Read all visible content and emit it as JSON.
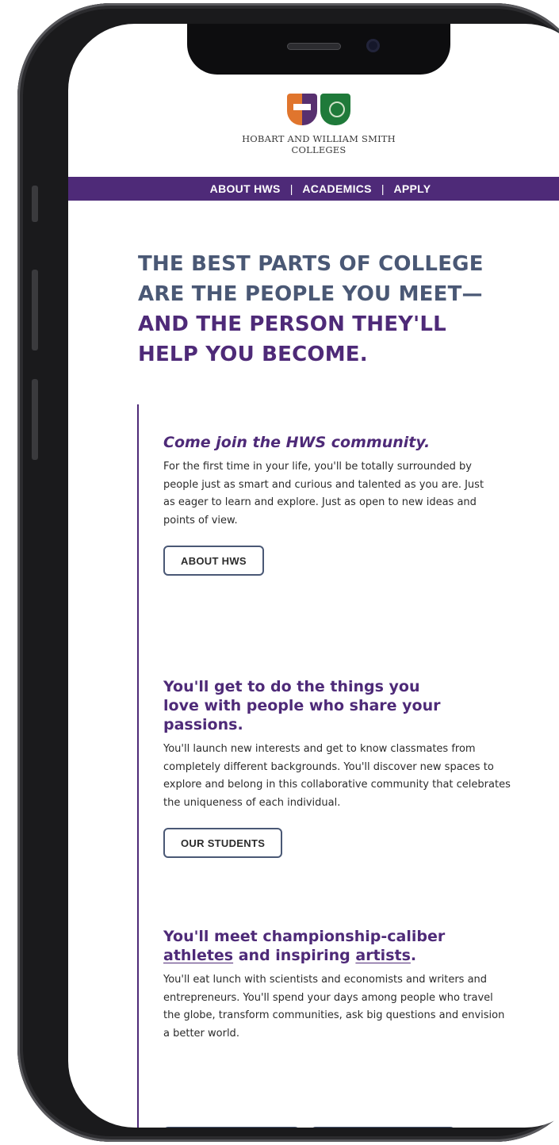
{
  "header": {
    "logo_line1": "HOBART AND WILLIAM SMITH",
    "logo_line2": "COLLEGES",
    "hobart_shield_icon": "hobart-shield-icon",
    "ws_shield_icon": "william-smith-shield-icon"
  },
  "nav": {
    "items": [
      "ABOUT HWS",
      "ACADEMICS",
      "APPLY"
    ],
    "separator": "|"
  },
  "hero": {
    "line1": "THE BEST PARTS OF COLLEGE",
    "line2": "ARE THE PEOPLE YOU MEET—",
    "line3": "AND THE PERSON THEY'LL",
    "line4": "HELP YOU BECOME."
  },
  "sections": [
    {
      "heading": "Come join the HWS community.",
      "body": "For the first time in your life, you'll be totally surrounded by people just as smart and curious and talented as you are. Just as eager to learn and explore. Just as open to new ideas and points of view.",
      "button": "ABOUT HWS"
    },
    {
      "heading": "You'll get to do the things you love with people who share your passions.",
      "body": "You'll launch new interests and get to know classmates from completely different backgrounds. You'll discover new spaces to explore and belong in this collaborative community that celebrates the uniqueness of each individual.",
      "button": "OUR STUDENTS"
    },
    {
      "heading_part1": "You'll meet championship-caliber",
      "heading_link1": "athletes",
      "heading_part2": "and inspiring",
      "heading_link2": "artists",
      "heading_part3": ".",
      "body": "You'll eat lunch with scientists and economists and writers and entrepreneurs. You'll spend your days among people who travel the globe, transform communities, ask big questions and envision a better world."
    }
  ],
  "colors": {
    "brand_purple": "#4e2a78",
    "slate": "#4a5875",
    "hobart_orange": "#e0752d",
    "ws_green": "#1f7a3a"
  }
}
